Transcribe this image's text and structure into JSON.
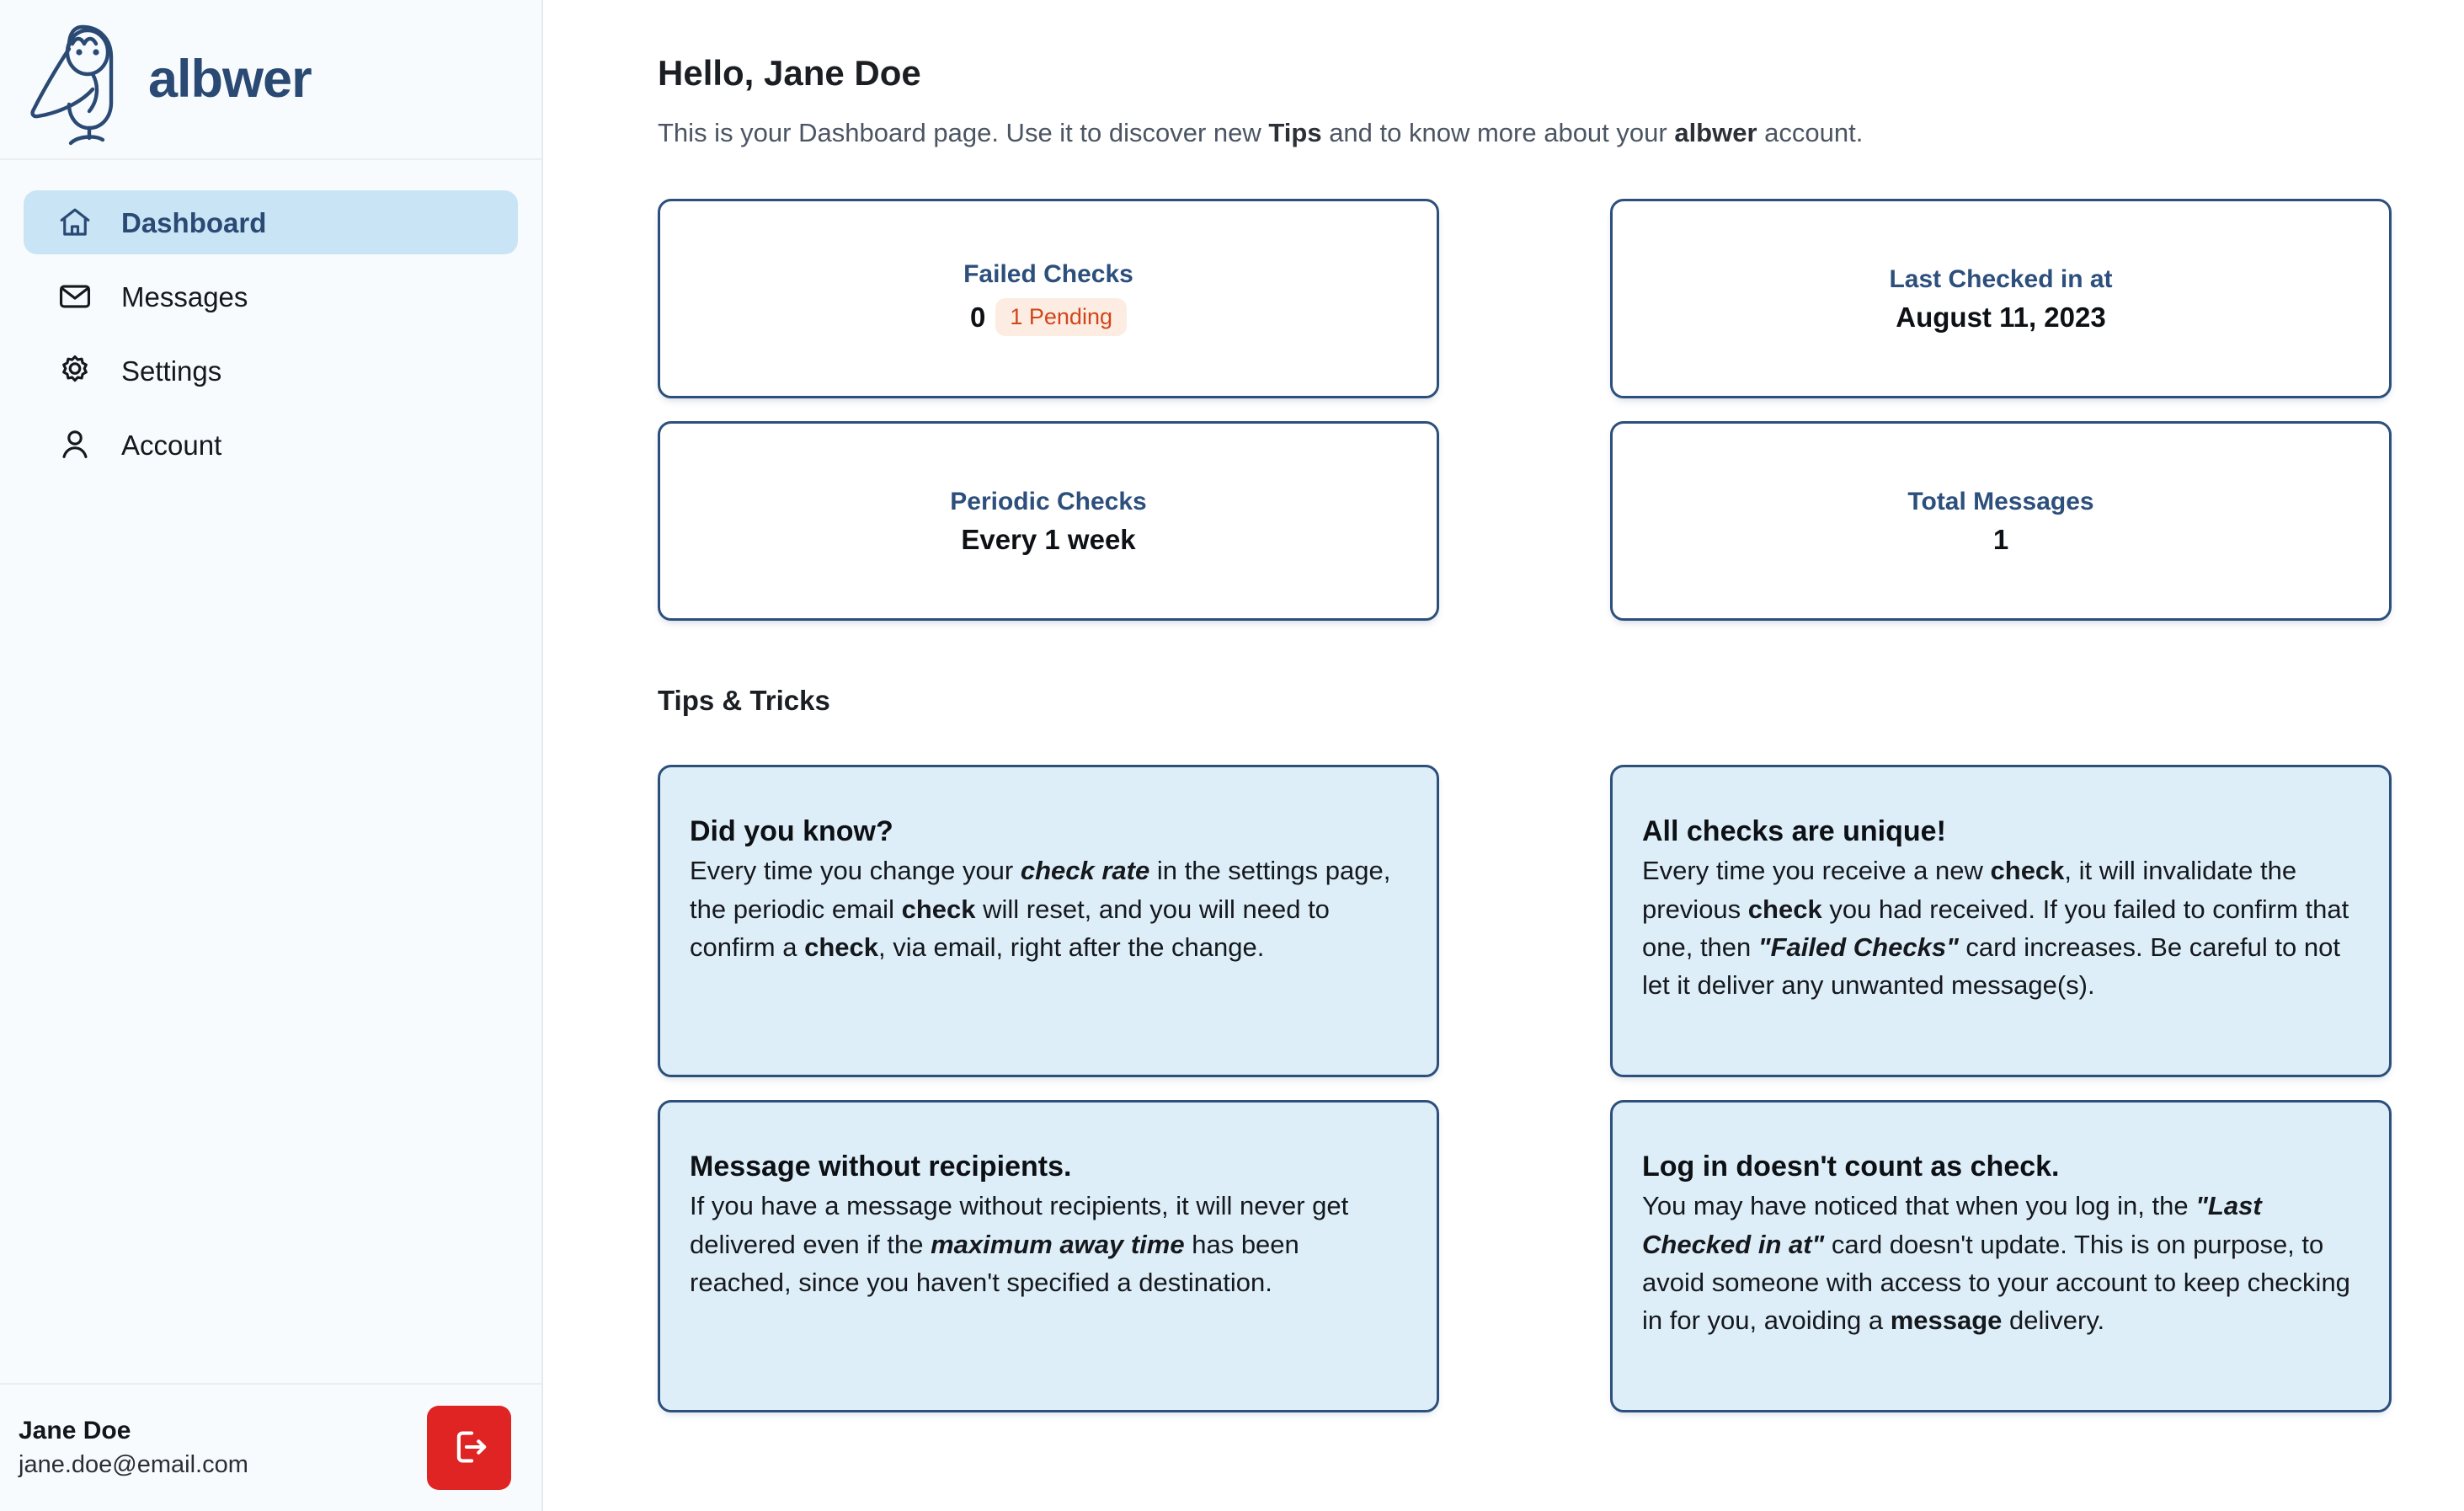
{
  "sidebar": {
    "brand": {
      "name": "albwer",
      "logo_icon": "owl-logo-icon"
    },
    "items": [
      {
        "label": "Dashboard",
        "icon": "home-icon",
        "active": true
      },
      {
        "label": "Messages",
        "icon": "envelope-icon",
        "active": false
      },
      {
        "label": "Settings",
        "icon": "gear-icon",
        "active": false
      },
      {
        "label": "Account",
        "icon": "user-icon",
        "active": false
      }
    ],
    "user": {
      "name": "Jane Doe",
      "email": "jane.doe@email.com",
      "logout_icon": "logout-icon"
    }
  },
  "main": {
    "title": "Hello, Jane Doe",
    "subtitle_part1": "This is your Dashboard page. Use it to discover new ",
    "subtitle_bold1": "Tips",
    "subtitle_part2": " and to know more about your ",
    "subtitle_bold2": "albwer",
    "subtitle_part3": " account.",
    "stats": [
      {
        "label": "Failed Checks",
        "value": "0",
        "badge": "1 Pending"
      },
      {
        "label": "Last Checked in at",
        "value": "August 11, 2023",
        "badge": ""
      },
      {
        "label": "Periodic Checks",
        "value": "Every 1 week",
        "badge": ""
      },
      {
        "label": "Total Messages",
        "value": "1",
        "badge": ""
      }
    ],
    "tips_section_title": "Tips & Tricks",
    "tips": [
      {
        "title": "Did you know?",
        "body_p1": "Every time you change your ",
        "body_i1": "check rate",
        "body_p2": " in the settings page, the periodic email ",
        "body_b1": "check",
        "body_p3": " will reset, and you will need to confirm a ",
        "body_b2": "check",
        "body_p4": ", via email, right after the change."
      },
      {
        "title": "All checks are unique!",
        "body_p1": "Every time you receive a new ",
        "body_b1": "check",
        "body_p2": ", it will invalidate the previous ",
        "body_b2": "check",
        "body_p3": " you had received. If you failed to confirm that one, then ",
        "body_i1": "\"Failed Checks\"",
        "body_p4": " card increases. Be careful to not let it deliver any unwanted message(s)."
      },
      {
        "title": "Message without recipients.",
        "body_p1": "If you have a message without recipients, it will never get delivered even if the ",
        "body_i1": "maximum away time",
        "body_p2": " has been reached, since you haven't specified a destination."
      },
      {
        "title": "Log in doesn't count as check.",
        "body_p1": "You may have noticed that when you log in, the ",
        "body_i1": "\"Last Checked in at\"",
        "body_p2": " card doesn't update. This is on purpose, to avoid someone with access to your account to keep checking in for you, avoiding a ",
        "body_b1": "message",
        "body_p3": " delivery."
      }
    ]
  },
  "colors": {
    "brand_navy": "#2a4a74",
    "card_border": "#2c4f7c",
    "tip_bg": "#ddeef8",
    "active_nav_bg": "#c9e4f5",
    "badge_bg": "#fdece1",
    "badge_text": "#d2451b",
    "logout_red": "#e02424",
    "sidebar_bg": "#f8fbfd"
  }
}
